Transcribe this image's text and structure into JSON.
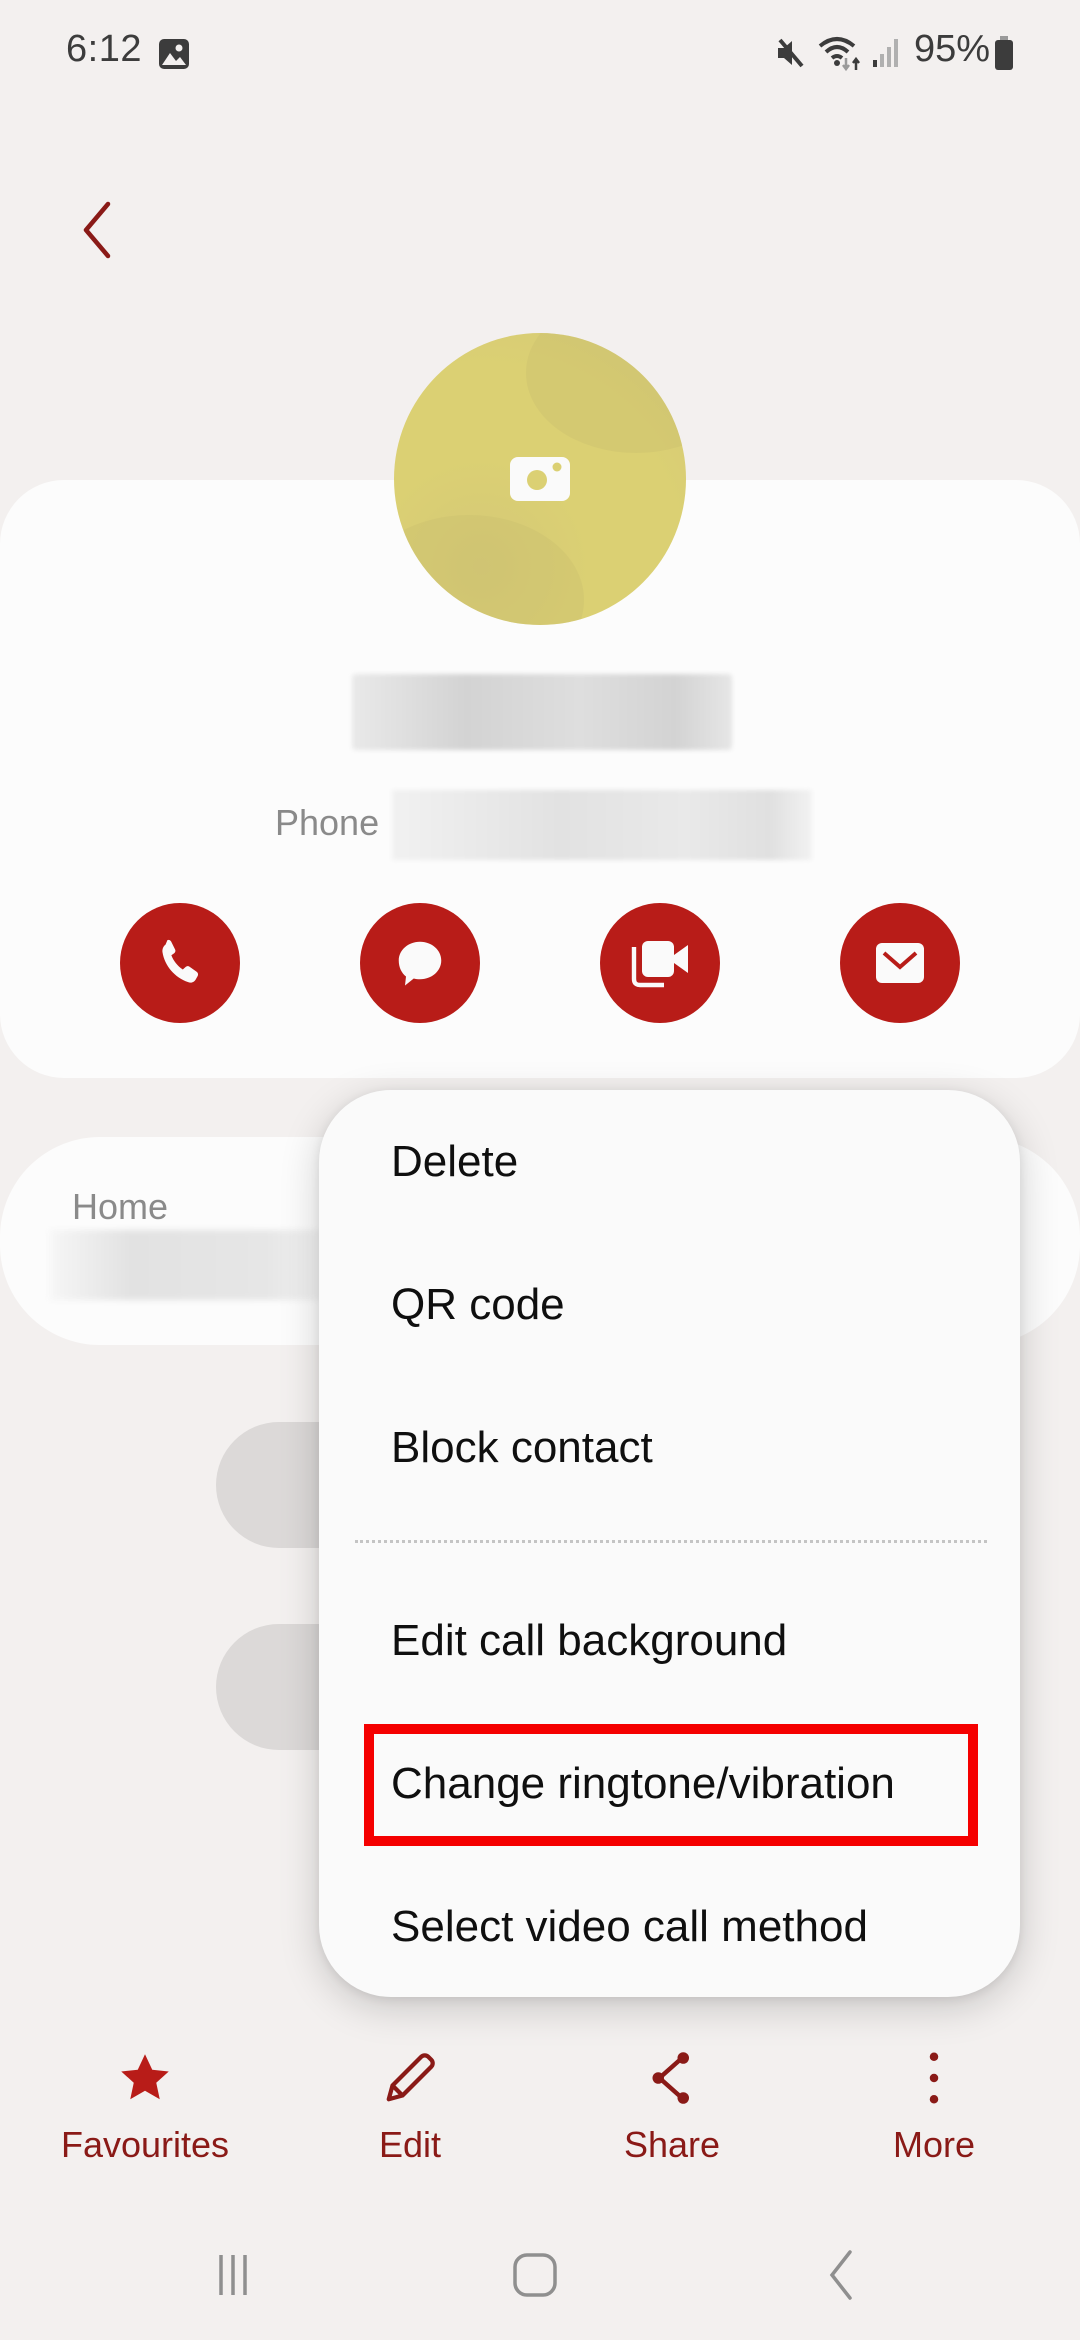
{
  "status_bar": {
    "time": "6:12",
    "battery_percent": "95%",
    "icons": [
      "gallery-icon",
      "mute-icon",
      "wifi-icon",
      "signal-icon",
      "battery-icon"
    ]
  },
  "header": {
    "back_icon": "chevron-left-icon"
  },
  "contact": {
    "name": "Redacted name",
    "phone_label": "Phone",
    "phone_value": "Redacted number",
    "avatar_icon": "camera-icon",
    "avatar_color": "#dbd073",
    "actions": [
      {
        "name": "call",
        "icon": "phone-icon"
      },
      {
        "name": "message",
        "icon": "message-icon"
      },
      {
        "name": "video-call",
        "icon": "video-icon"
      },
      {
        "name": "email",
        "icon": "email-icon"
      }
    ]
  },
  "details": {
    "home_label": "Home",
    "home_value": "Redacted address"
  },
  "menu": {
    "items": [
      {
        "label": "Delete"
      },
      {
        "label": "QR code"
      },
      {
        "label": "Block contact"
      },
      {
        "label": "Edit call background"
      },
      {
        "label": "Change ringtone/vibration",
        "highlighted": true
      },
      {
        "label": "Select video call method"
      }
    ]
  },
  "bottom_bar": {
    "favourites": "Favourites",
    "edit": "Edit",
    "share": "Share",
    "more": "More"
  },
  "nav_bar": {
    "buttons": [
      "recents",
      "home",
      "back"
    ]
  },
  "colors": {
    "background": "#f3f0ef",
    "card": "#fcfcfc",
    "accent_red": "#b81c18",
    "label_dark_red": "#8a1a17",
    "highlight_box": "#f50000"
  }
}
